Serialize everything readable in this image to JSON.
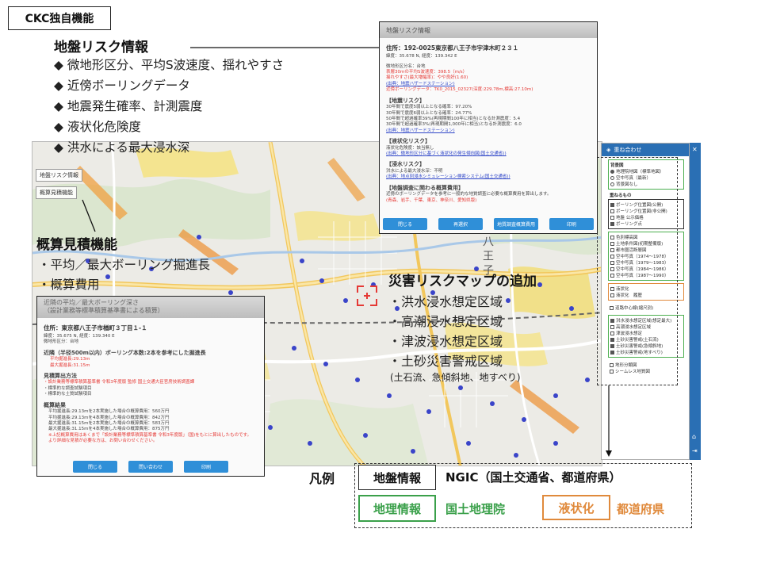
{
  "title": "CKC独自機能",
  "ground_risk": {
    "heading": "地盤リスク情報",
    "items": [
      "◆ 微地形区分、平均S波速度、揺れやすさ",
      "◆ 近傍ボーリングデータ",
      "◆ 地震発生確率、計測震度",
      "◆ 液状化危険度",
      "◆ 洪水による最大浸水深"
    ]
  },
  "estimate": {
    "heading": "概算見積機能",
    "items": [
      "・平均／最大ボーリング掘進長",
      "・概算費用"
    ]
  },
  "hazard": {
    "heading": "災害リスクマップの追加",
    "items": [
      "・洪水浸水想定区域",
      "・高潮浸水想定区域",
      "・津波浸水想定区域",
      "・土砂災害警戒区域"
    ],
    "note": "(土石流、急傾斜地、地すべり)"
  },
  "map": {
    "label_risk": "地盤リスク情報",
    "label_estimate": "概算見積機能",
    "town_label": "八王子"
  },
  "panel": {
    "header": "重ね合わせ",
    "base_title": "背景図",
    "base_items": [
      {
        "label": "地理院地図（標準地図）",
        "on": true
      },
      {
        "label": "空中写真（最新）",
        "on": false
      },
      {
        "label": "背景図なし",
        "on": false
      }
    ],
    "overlay_title": "重ねるもの",
    "overlay_k": [
      {
        "label": "ボーリング位置図(公開)",
        "on": true
      },
      {
        "label": "ボーリング位置図(非公開)",
        "on": false
      },
      {
        "label": "地盤 公示価格",
        "on": false
      },
      {
        "label": "ボーリング点",
        "on": true
      }
    ],
    "overlay_g": [
      {
        "label": "色別標高図",
        "on": false
      },
      {
        "label": "土地条件図(初期整備版)",
        "on": false
      },
      {
        "label": "都市圏活断層図",
        "on": false
      },
      {
        "label": "空中写真（1974～1978）",
        "on": false
      },
      {
        "label": "空中写真（1979～1983）",
        "on": false
      },
      {
        "label": "空中写真（1984～1986）",
        "on": false
      },
      {
        "label": "空中写真（1987～1990）",
        "on": false
      }
    ],
    "overlay_o": [
      {
        "label": "液状化",
        "on": false
      },
      {
        "label": "液状化　履歴",
        "on": false
      }
    ],
    "overlay_mid": [
      {
        "label": "道路中心線(縮尺別)",
        "on": false
      }
    ],
    "overlay_g2": [
      {
        "label": "洪水浸水想定区域(想定最大)",
        "on": true
      },
      {
        "label": "高潮浸水想定区域",
        "on": false
      },
      {
        "label": "津波浸水想定",
        "on": false
      },
      {
        "label": "土砂災害警戒(土石流)",
        "on": true
      },
      {
        "label": "土砂災害警戒(急傾斜地)",
        "on": true
      },
      {
        "label": "土砂災害警戒(地すべり)",
        "on": true
      }
    ],
    "overlay_tail": [
      {
        "label": "地形分類図",
        "on": false
      },
      {
        "label": "シームレス地質図",
        "on": false
      }
    ]
  },
  "dialog_risk": {
    "title": "地盤リスク情報",
    "address": "住所：192-0025東京都八王子市宇津木町２３１",
    "coords": "緯度：35.678 N, 経度：139.342 E",
    "lines": [
      "微地形区分名：台地",
      "表層30mの平均S波速度：398.5（m/s）",
      "揺れやすさ(最大増幅率)：やや良好(1.60)",
      "(出典：地震ハザードステーション)",
      "近傍ボーリングデータ：TK0_2015_02327(深度:229.78m,標高:27.10m)"
    ],
    "sec1": "【地震リスク】",
    "sec1_lines": [
      "30年間で震度5弱以上となる確率：97.20%",
      "30年間で震度6弱以上となる確率：24.77%",
      "50年間で超過確率39%(再現期間100年に相当)となる計測震度：5.4",
      "30年間で超過確率3%(再現期間1,000年に相当)となる計測震度：6.0",
      "(出典：地震ハザードステーション)"
    ],
    "sec2": "【液状化リスク】",
    "sec2_lines": [
      "液状化危険度：該当無し",
      "(出典：微地形区分に基づく液状化の発生傾向図(国土交通省))"
    ],
    "sec3": "【浸水リスク】",
    "sec3_lines": [
      "洪水による最大浸水深：不明",
      "(出典：地点別浸水シミュレーション検索システム(国土交通省))"
    ],
    "sec4": "【地盤調査に関わる概算費用】",
    "sec4_lines": [
      "近傍のボーリングデータを参考に一般的な地質調査に必要な概算費用を算出します。",
      "(青森、岩手、千葉、東京、神奈川、愛知県版)"
    ],
    "buttons": [
      "閉じる",
      "再選択",
      "地質調査概算費用",
      "印刷"
    ]
  },
  "dialog_est": {
    "title1": "近隣の平均／最大ボーリング深さ",
    "title2": "（設計業務等標準積算基準書による積算）",
    "address": "住所：東京都八王子市楢町３丁目１-１",
    "coords": "緯度：35.675 N, 経度：139.340 E",
    "micro": "微地形区分：台地",
    "sec1": "近隣（半径500m以内）ボーリング本数:2本を参考にした掘進長",
    "sec1_lines": [
      "平均掘進長:29.13m",
      "最大掘進長:31.15m"
    ],
    "sec2": "見積算出方法",
    "sec2_lines": [
      "・設計業務等標準積算基準書 令和3年度版 監修 国土交通大臣官房技術調査課",
      "・標準的な調査試験項目",
      "・標準的な土質試験項目"
    ],
    "sec3": "概算結果",
    "sec3_lines": [
      "平均掘進長:29.13mを2本実施した場合の概算費用：560万円",
      "平均掘進長:29.13mを4本実施した場合の概算費用：842万円",
      "最大掘進長:31.15mを2本実施した場合の概算費用：583万円",
      "最大掘進長:31.15mを4本実施した場合の概算費用：875万円",
      "※上記概算費用はあくまで「設計業務等標準積算基準書 令和3年度版」（国)をもとに算出したものです。",
      "より詳細な見積が必要な方は、お問い合わせください。"
    ],
    "buttons": [
      "閉じる",
      "問い合わせ",
      "印刷"
    ]
  },
  "legend": {
    "title": "凡例",
    "box1": "地盤情報",
    "text1": "NGIC（国土交通省、都道府県）",
    "box2": "地理情報",
    "text2": "国土地理院",
    "box3": "液状化",
    "text3": "都道府県"
  },
  "colors": {
    "green": "#3aa04a",
    "orange": "#e08a3c",
    "red": "#e53935",
    "panel_blue": "#2a6fb4"
  }
}
